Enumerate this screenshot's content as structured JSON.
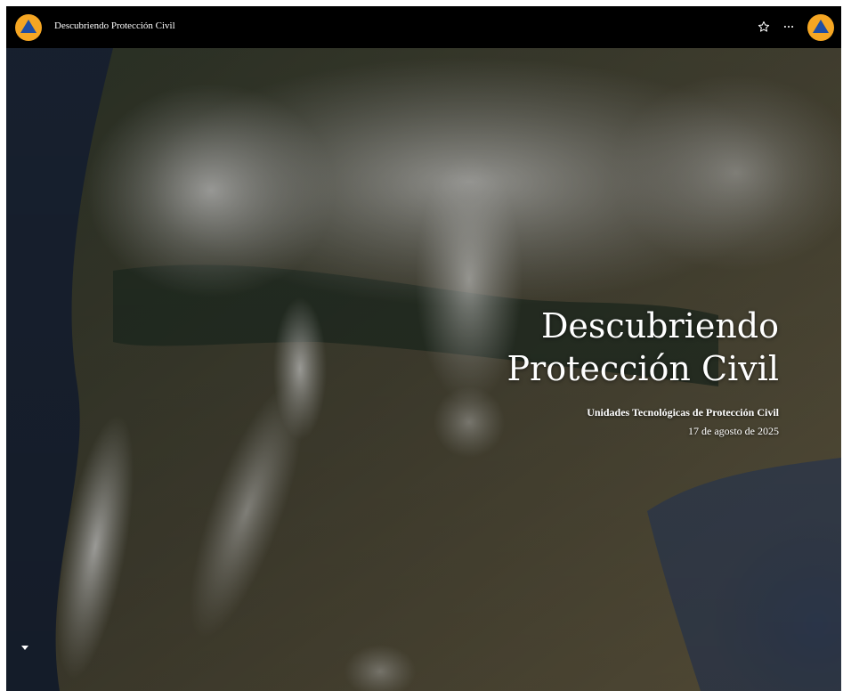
{
  "app": {
    "title": "Descubriendo Protección Civil",
    "logo_icon": "civil-protection-logo-icon",
    "accent_color": "#f5a623",
    "logo_triangle_color": "#1f4ea3"
  },
  "toolbar": {
    "favorite_icon": "star-outline-icon",
    "more_icon": "more-horizontal-icon"
  },
  "hero": {
    "title_line1": "Descubriendo",
    "title_line2": "Protección Civil",
    "author": "Unidades Tecnológicas de Protección Civil",
    "date": "17 de agosto de 2025",
    "scroll_icon": "arrow-down-icon"
  }
}
